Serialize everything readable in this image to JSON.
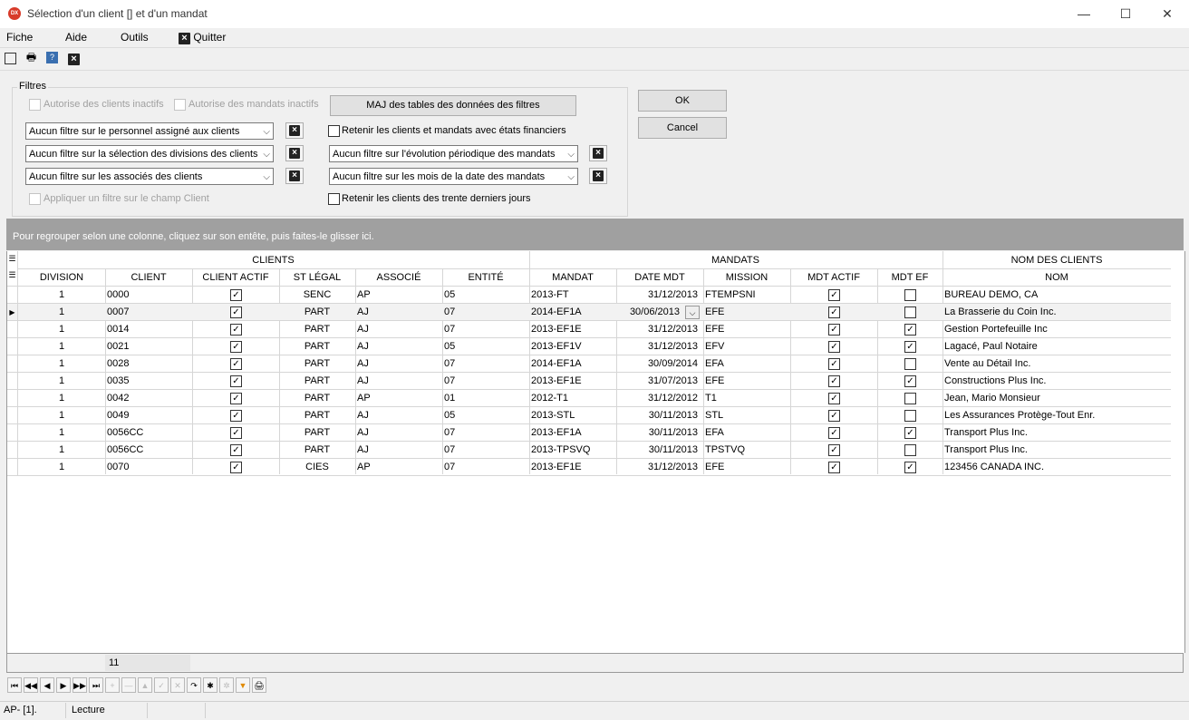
{
  "window": {
    "title": "Sélection d'un client [] et d'un mandat",
    "minimize": "—",
    "maximize": "☐",
    "close": "✕",
    "icon_text": "DX"
  },
  "menu": {
    "fiche": "Fiche",
    "aide": "Aide",
    "outils": "Outils",
    "quitter": "Quitter"
  },
  "toolbar": {
    "icons": [
      "zoom-fit-icon",
      "print-icon",
      "preview-icon",
      "close-icon"
    ]
  },
  "filters": {
    "group_label": "Filtres",
    "allow_inactive_clients": "Autorise des clients inactifs",
    "allow_inactive_mandates": "Autorise des mandats inactifs",
    "update_button": "MAJ des tables des données des filtres",
    "staff_filter": "Aucun filtre sur le personnel assigné aux clients",
    "division_filter": "Aucun filtre sur la sélection des divisions des clients",
    "associates_filter": "Aucun filtre sur les associés des clients",
    "apply_client_field_filter": "Appliquer un filtre sur le champ Client",
    "retain_financial_states": "Retenir les clients et mandats avec états financiers",
    "periodic_filter": "Aucun filtre sur l'évolution périodique des mandats",
    "month_filter": "Aucun filtre sur les mois de la date des mandats",
    "retain_last_30_days": "Retenir les clients des trente derniers jours"
  },
  "dialog_buttons": {
    "ok": "OK",
    "cancel": "Cancel"
  },
  "group_band_text": "Pour regrouper selon une colonne, cliquez sur son entête, puis faites-le glisser ici.",
  "grid": {
    "bands": {
      "clients": "CLIENTS",
      "mandats": "MANDATS",
      "noms": "NOM DES CLIENTS"
    },
    "columns": [
      "DIVISION",
      "CLIENT",
      "CLIENT ACTIF",
      "ST LÉGAL",
      "ASSOCIÉ",
      "ENTITÉ",
      "MANDAT",
      "DATE MDT",
      "MISSION",
      "MDT ACTIF",
      "MDT EF",
      "NOM"
    ],
    "rows": [
      {
        "division": "1",
        "client": "0000",
        "actif": true,
        "st_legal": "SENC",
        "associe": "AP",
        "entite": "05",
        "mandat": "2013-FT",
        "date": "31/12/2013",
        "mission": "FTEMPSNI",
        "mdt_actif": true,
        "mdt_ef": false,
        "nom": "BUREAU DEMO, CA"
      },
      {
        "division": "1",
        "client": "0007",
        "actif": true,
        "st_legal": "PART",
        "associe": "AJ",
        "entite": "07",
        "mandat": "2014-EF1A",
        "date": "30/06/2013",
        "mission": "EFE",
        "mdt_actif": true,
        "mdt_ef": false,
        "nom": "La Brasserie du Coin Inc."
      },
      {
        "division": "1",
        "client": "0014",
        "actif": true,
        "st_legal": "PART",
        "associe": "AJ",
        "entite": "07",
        "mandat": "2013-EF1E",
        "date": "31/12/2013",
        "mission": "EFE",
        "mdt_actif": true,
        "mdt_ef": true,
        "nom": "Gestion Portefeuille Inc"
      },
      {
        "division": "1",
        "client": "0021",
        "actif": true,
        "st_legal": "PART",
        "associe": "AJ",
        "entite": "05",
        "mandat": "2013-EF1V",
        "date": "31/12/2013",
        "mission": "EFV",
        "mdt_actif": true,
        "mdt_ef": true,
        "nom": "Lagacé, Paul Notaire"
      },
      {
        "division": "1",
        "client": "0028",
        "actif": true,
        "st_legal": "PART",
        "associe": "AJ",
        "entite": "07",
        "mandat": "2014-EF1A",
        "date": "30/09/2014",
        "mission": "EFA",
        "mdt_actif": true,
        "mdt_ef": false,
        "nom": "Vente au Détail Inc."
      },
      {
        "division": "1",
        "client": "0035",
        "actif": true,
        "st_legal": "PART",
        "associe": "AJ",
        "entite": "07",
        "mandat": "2013-EF1E",
        "date": "31/07/2013",
        "mission": "EFE",
        "mdt_actif": true,
        "mdt_ef": true,
        "nom": "Constructions Plus  Inc."
      },
      {
        "division": "1",
        "client": "0042",
        "actif": true,
        "st_legal": "PART",
        "associe": "AP",
        "entite": "01",
        "mandat": "2012-T1",
        "date": "31/12/2012",
        "mission": "T1",
        "mdt_actif": true,
        "mdt_ef": false,
        "nom": "Jean, Mario Monsieur"
      },
      {
        "division": "1",
        "client": "0049",
        "actif": true,
        "st_legal": "PART",
        "associe": "AJ",
        "entite": "05",
        "mandat": "2013-STL",
        "date": "30/11/2013",
        "mission": "STL",
        "mdt_actif": true,
        "mdt_ef": false,
        "nom": "Les Assurances Protège-Tout Enr."
      },
      {
        "division": "1",
        "client": "0056CC",
        "actif": true,
        "st_legal": "PART",
        "associe": "AJ",
        "entite": "07",
        "mandat": "2013-EF1A",
        "date": "30/11/2013",
        "mission": "EFA",
        "mdt_actif": true,
        "mdt_ef": true,
        "nom": "Transport Plus Inc."
      },
      {
        "division": "1",
        "client": "0056CC",
        "actif": true,
        "st_legal": "PART",
        "associe": "AJ",
        "entite": "07",
        "mandat": "2013-TPSVQ",
        "date": "30/11/2013",
        "mission": "TPSTVQ",
        "mdt_actif": true,
        "mdt_ef": false,
        "nom": "Transport Plus Inc."
      },
      {
        "division": "1",
        "client": "0070",
        "actif": true,
        "st_legal": "CIES",
        "associe": "AP",
        "entite": "07",
        "mandat": "2013-EF1E",
        "date": "31/12/2013",
        "mission": "EFE",
        "mdt_actif": true,
        "mdt_ef": true,
        "nom": "123456 CANADA INC."
      }
    ],
    "selected_row": 1,
    "record_count": "11"
  },
  "navigator": [
    "⏮",
    "◀◀",
    "◀",
    "▶",
    "▶▶",
    "⏭",
    "+",
    "—",
    "▲",
    "✓",
    "✕",
    "↷",
    "✱",
    "✲",
    "▼",
    "🖨"
  ],
  "status": {
    "left": "AP- [1].",
    "mode": "Lecture"
  }
}
